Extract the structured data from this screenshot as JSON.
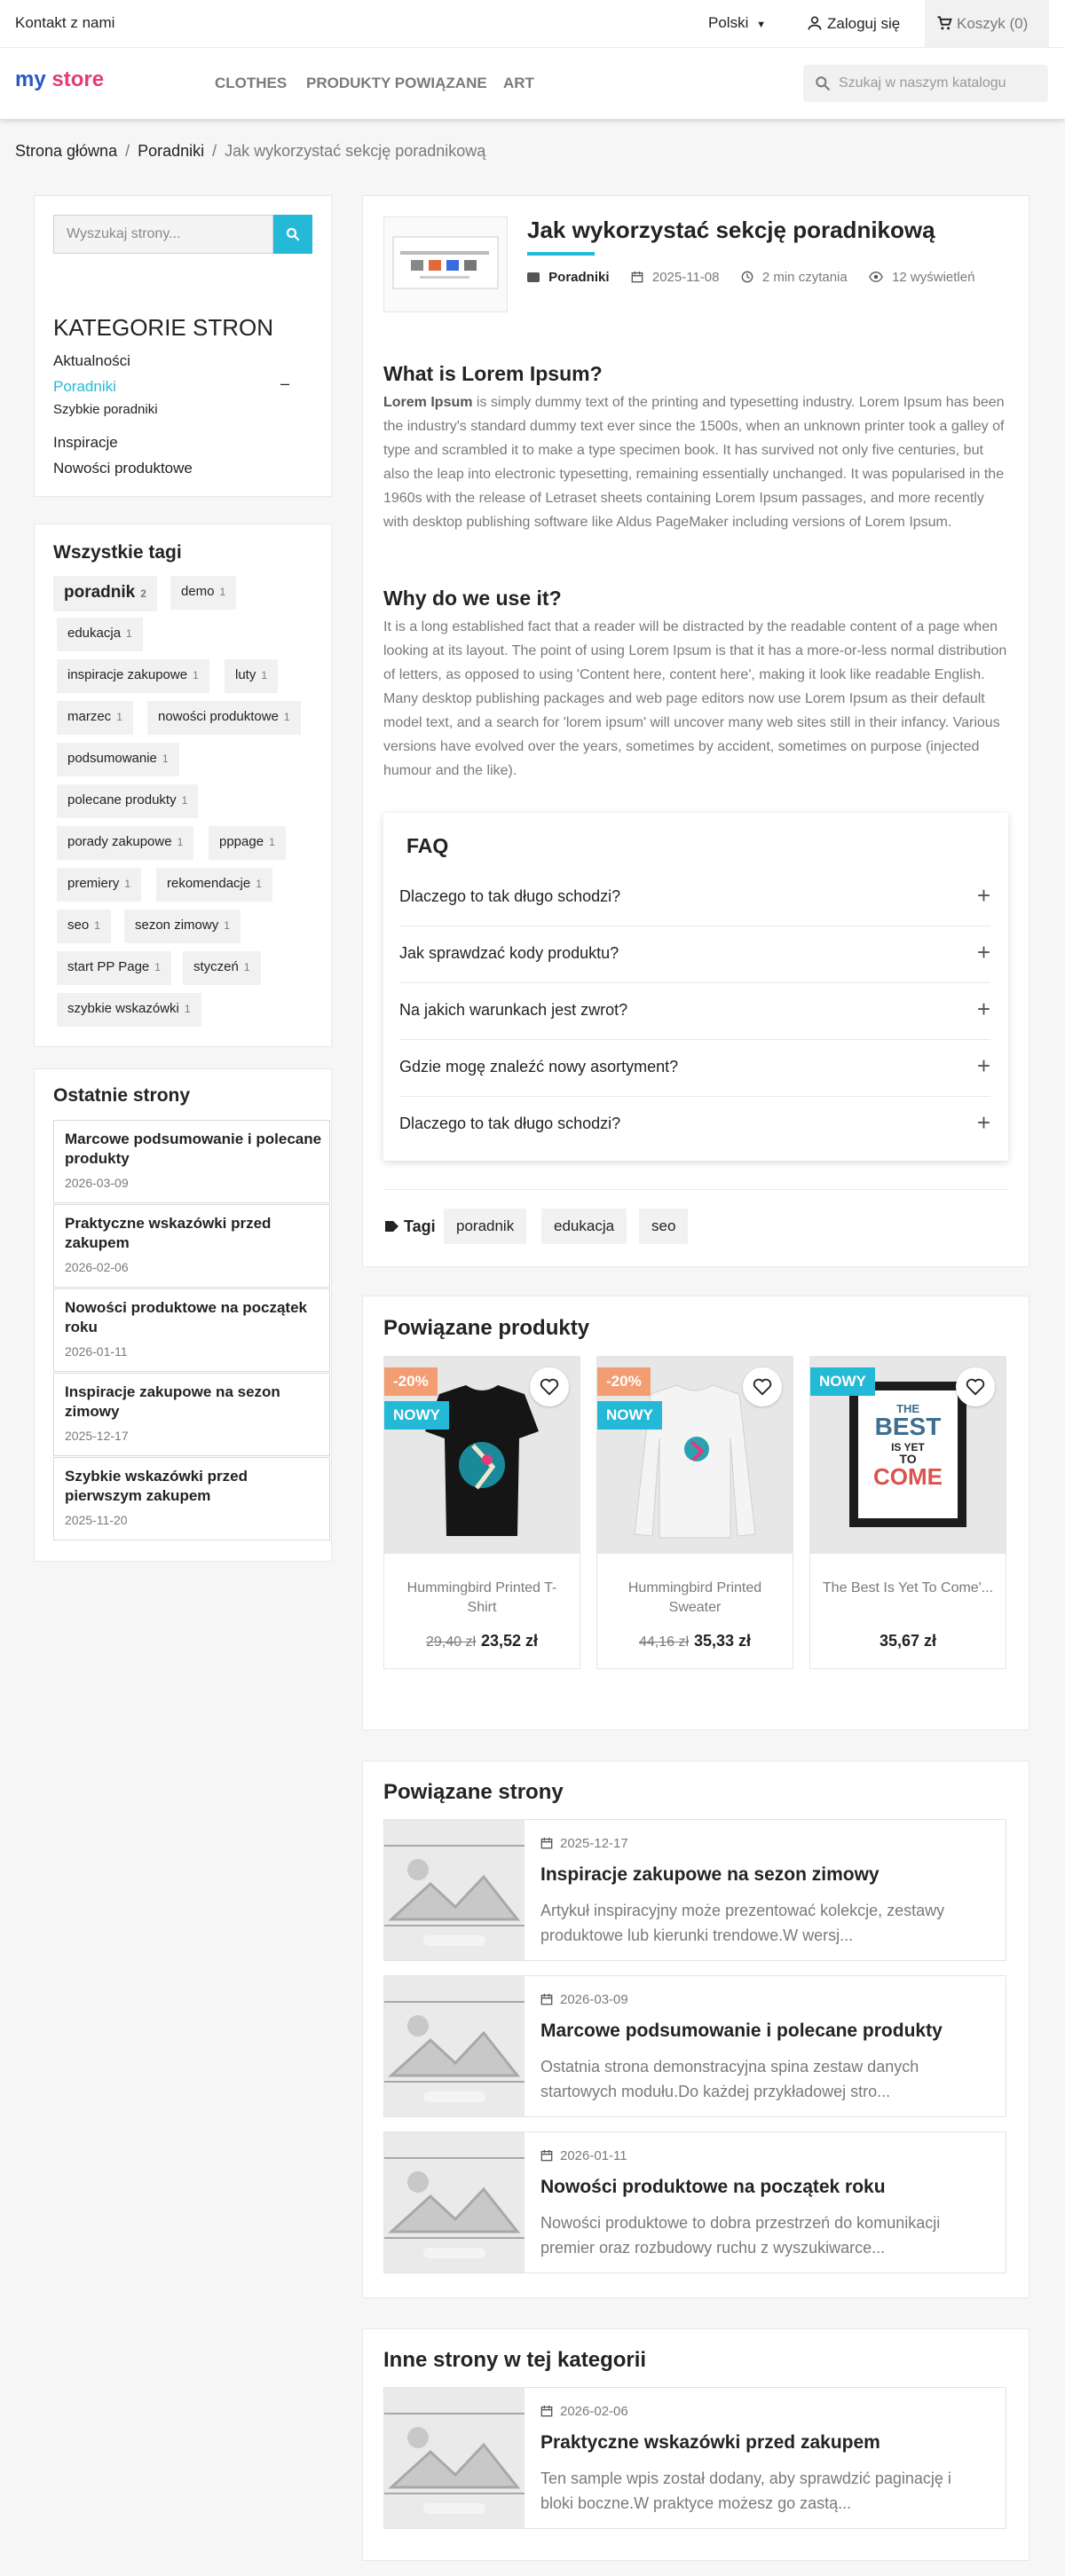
{
  "topbar": {
    "contact": "Kontakt z nami",
    "language": "Polski",
    "login": "Zaloguj się",
    "cart": "Koszyk (0)"
  },
  "header": {
    "logo_part1": "my",
    "logo_part2": "store",
    "nav": [
      "CLOTHES",
      "PRODUKTY POWIĄZANE",
      "ART"
    ],
    "search_placeholder": "Szukaj w naszym katalogu"
  },
  "breadcrumb": [
    "Strona główna",
    "Poradniki",
    "Jak wykorzystać sekcję poradnikową"
  ],
  "sidebar": {
    "search_placeholder": "Wyszukaj strony...",
    "categories_title": "KATEGORIE STRON",
    "categories": {
      "aktualnosci": "Aktualności",
      "poradniki": "Poradniki",
      "poradniki_toggle": "–",
      "szybkie": "Szybkie poradniki",
      "inspiracje": "Inspiracje",
      "nowosci": "Nowości produktowe"
    },
    "tags_title": "Wszystkie tagi",
    "tags": [
      {
        "name": "poradnik",
        "count": "2"
      },
      {
        "name": "demo",
        "count": "1"
      },
      {
        "name": "edukacja",
        "count": "1"
      },
      {
        "name": "inspiracje zakupowe",
        "count": "1"
      },
      {
        "name": "luty",
        "count": "1"
      },
      {
        "name": "marzec",
        "count": "1"
      },
      {
        "name": "nowości produktowe",
        "count": "1"
      },
      {
        "name": "podsumowanie",
        "count": "1"
      },
      {
        "name": "polecane produkty",
        "count": "1"
      },
      {
        "name": "porady zakupowe",
        "count": "1"
      },
      {
        "name": "pppage",
        "count": "1"
      },
      {
        "name": "premiery",
        "count": "1"
      },
      {
        "name": "rekomendacje",
        "count": "1"
      },
      {
        "name": "seo",
        "count": "1"
      },
      {
        "name": "sezon zimowy",
        "count": "1"
      },
      {
        "name": "start PP Page",
        "count": "1"
      },
      {
        "name": "styczeń",
        "count": "1"
      },
      {
        "name": "szybkie wskazówki",
        "count": "1"
      }
    ],
    "recent_title": "Ostatnie strony",
    "recent": [
      {
        "title": "Marcowe podsumowanie i polecane produkty",
        "date": "2026-03-09"
      },
      {
        "title": "Praktyczne wskazówki przed zakupem",
        "date": "2026-02-06"
      },
      {
        "title": "Nowości produktowe na początek roku",
        "date": "2026-01-11"
      },
      {
        "title": "Inspiracje zakupowe na sezon zimowy",
        "date": "2025-12-17"
      },
      {
        "title": "Szybkie wskazówki przed pierwszym zakupem",
        "date": "2025-11-20"
      }
    ]
  },
  "article": {
    "title": "Jak wykorzystać sekcję poradnikową",
    "category": "Poradniki",
    "date": "2025-11-08",
    "reading": "2 min czytania",
    "views": "12 wyświetleń",
    "h1": "What is Lorem Ipsum?",
    "p1_bold": "Lorem Ipsum",
    "p1": " is simply dummy text of the printing and typesetting industry. Lorem Ipsum has been the industry's standard dummy text ever since the 1500s, when an unknown printer took a galley of type and scrambled it to make a type specimen book. It has survived not only five centuries, but also the leap into electronic typesetting, remaining essentially unchanged. It was popularised in the 1960s with the release of Letraset sheets containing Lorem Ipsum passages, and more recently with desktop publishing software like Aldus PageMaker including versions of Lorem Ipsum.",
    "h2": "Why do we use it?",
    "p2": "It is a long established fact that a reader will be distracted by the readable content of a page when looking at its layout. The point of using Lorem Ipsum is that it has a more-or-less normal distribution of letters, as opposed to using 'Content here, content here', making it look like readable English. Many desktop publishing packages and web page editors now use Lorem Ipsum as their default model text, and a search for 'lorem ipsum' will uncover many web sites still in their infancy. Various versions have evolved over the years, sometimes by accident, sometimes on purpose (injected humour and the like).",
    "faq_title": "FAQ",
    "faq": [
      "Dlaczego to tak długo schodzi?",
      "Jak sprawdzać kody produktu?",
      "Na jakich warunkach jest zwrot?",
      "Gdzie mogę znaleźć nowy asortyment?",
      "Dlaczego to tak długo schodzi?"
    ],
    "faq_toggle": "+",
    "tags_label": "Tagi",
    "tags": [
      "poradnik",
      "edukacja",
      "seo"
    ]
  },
  "related_products": {
    "title": "Powiązane produkty",
    "items": [
      {
        "name": "Hummingbird Printed T-Shirt",
        "old_price": "29,40 zł",
        "price": "23,52 zł",
        "sale": "-20%",
        "new": "NOWY"
      },
      {
        "name": "Hummingbird Printed Sweater",
        "old_price": "44,16 zł",
        "price": "35,33 zł",
        "sale": "-20%",
        "new": "NOWY"
      },
      {
        "name": "The Best Is Yet To Come'...",
        "old_price": "",
        "price": "35,67 zł",
        "sale": "",
        "new": "NOWY"
      }
    ],
    "poster_lines": [
      "THE",
      "BEST",
      "IS YET",
      "TO",
      "COME"
    ]
  },
  "related_pages": {
    "title": "Powiązane strony",
    "items": [
      {
        "date": "2025-12-17",
        "title": "Inspiracje zakupowe na sezon zimowy",
        "excerpt": "Artykuł inspiracyjny może prezentować kolekcje, zestawy produktowe lub kierunki trendowe.W wersj..."
      },
      {
        "date": "2026-03-09",
        "title": "Marcowe podsumowanie i polecane produkty",
        "excerpt": "Ostatnia strona demonstracyjna spina zestaw danych startowych modułu.Do każdej przykładowej stro..."
      },
      {
        "date": "2026-01-11",
        "title": "Nowości produktowe na początek roku",
        "excerpt": "Nowości produktowe to dobra przestrzeń do komunikacji premier oraz rozbudowy ruchu z wyszukiwarce..."
      }
    ]
  },
  "other_pages": {
    "title": "Inne strony w tej kategorii",
    "items": [
      {
        "date": "2026-02-06",
        "title": "Praktyczne wskazówki przed zakupem",
        "excerpt": "Ten sample wpis został dodany, aby sprawdzić paginację i bloki boczne.W praktyce możesz go zastą..."
      }
    ]
  },
  "colors": {
    "accent": "#24b9d7",
    "sale": "#f39d72",
    "text": "#232323",
    "muted": "#7a7a7a",
    "background": "#f6f6f6"
  }
}
